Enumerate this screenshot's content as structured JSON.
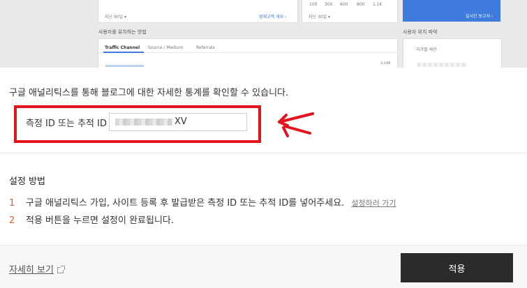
{
  "preview": {
    "panel1_footer": "지난 90일 ▾",
    "panel1_link": "잠재고객 개요 ›",
    "panel2_ticks": [
      "100",
      "300",
      "600",
      "800",
      "1.1K"
    ],
    "panel2_footer": "지난 30일 ▾",
    "panel3_link": "실시간 보고서 ›",
    "section_left": "사용자를 유치하는 방법",
    "section_right": "사용자 위치 파악",
    "tabs": [
      "Traffic Channel",
      "Source / Medium",
      "Referrals"
    ],
    "axis_value": "3,198",
    "map_label": "국가별 세션"
  },
  "dialog": {
    "intro": "구글 애널리틱스를 통해 블로그에 대한 자세한 통계를 확인할 수 있습니다.",
    "field_label": "측정 ID 또는 추적 ID",
    "field_value_visible": "XV",
    "howto_title": "설정 방법",
    "steps": [
      {
        "num": "1",
        "text": "구글 애널리틱스 가입, 사이트 등록 후 발급받은 측정 ID 또는 추적 ID를 넣어주세요.",
        "link": "설정하러 가기"
      },
      {
        "num": "2",
        "text": "적용 버튼을 누르면 설정이 완료됩니다."
      }
    ],
    "more_link": "자세히 보기",
    "apply_label": "적용"
  },
  "colors": {
    "highlight": "#e3141b",
    "step_number": "#e4572e",
    "button": "#2b2b2b",
    "accent_blue": "#3f7bdc"
  }
}
